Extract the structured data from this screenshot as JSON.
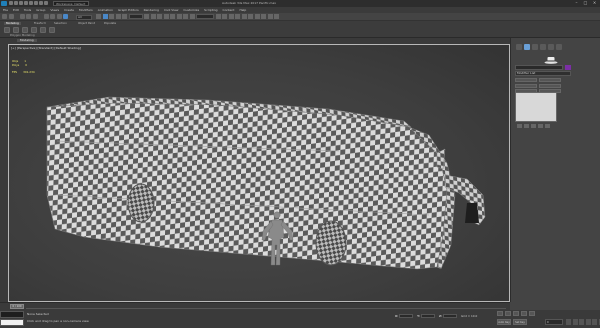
{
  "title_bar": {
    "workspace_label": "Workspace: Default",
    "window_title": "Autodesk 3ds Max 2017     Pacific.max"
  },
  "menu_bar": {
    "items": [
      "File",
      "Edit",
      "Tools",
      "Group",
      "Views",
      "Create",
      "Modifiers",
      "Animation",
      "Graph Editors",
      "Rendering",
      "Civil View",
      "Customize",
      "Scripting",
      "Content",
      "Help"
    ]
  },
  "toolbar": {
    "selection_filter": "All"
  },
  "ribbon": {
    "tabs": [
      "Modeling",
      "Freeform",
      "Selection",
      "Object Paint",
      "Populate"
    ],
    "active_tab": "Modeling",
    "panel_label": "Polygon Modeling"
  },
  "viewport": {
    "tab_label": "Modeling",
    "label": "[+] [Perspective] [Standard] [Default Shading]",
    "stats": [
      {
        "label": "Objs",
        "value": "1"
      },
      {
        "label": "Polys",
        "value": "0"
      },
      {
        "label": "FPS",
        "value": "301.234"
      }
    ]
  },
  "command_panel": {
    "tabs": [
      "create",
      "modify",
      "hierarchy",
      "motion",
      "display",
      "utilities"
    ],
    "modifier_list_label": "Modifier List",
    "object_color": "#7b2fa5"
  },
  "timeline": {
    "slider_label": "0 / 100"
  },
  "status_bar": {
    "line1": "None Selected",
    "line2": "Click and drag to pan a non-camera view",
    "coords": [
      {
        "axis": "X:"
      },
      {
        "axis": "Y:"
      },
      {
        "axis": "Z:"
      }
    ],
    "grid": "Grid = 10.0",
    "autokey": "Auto Key",
    "setkey": "Set Key",
    "frame": "0"
  },
  "colors": {
    "accent": "#4a88c8",
    "stats_text": "#e9e36a",
    "viewport_border": "#b8b8b8"
  }
}
